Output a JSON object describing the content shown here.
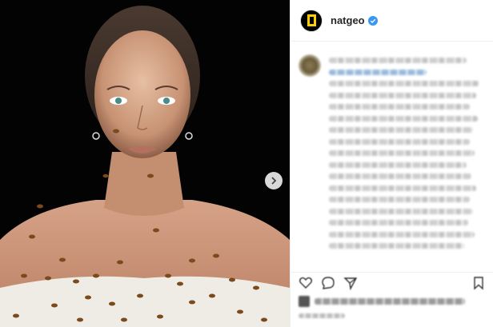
{
  "header": {
    "username": "natgeo",
    "verified_icon": "verified-badge-icon",
    "avatar_icon": "natgeo-logo-icon"
  },
  "media": {
    "next_icon": "chevron-right-icon"
  },
  "caption": {
    "blurred": true,
    "line_count": 17
  },
  "actions": {
    "icons": [
      "heart-icon",
      "comment-icon",
      "share-icon",
      "bookmark-icon"
    ]
  },
  "colors": {
    "accent": "#ffce00",
    "verified": "#3897f0",
    "background": "#000000"
  }
}
